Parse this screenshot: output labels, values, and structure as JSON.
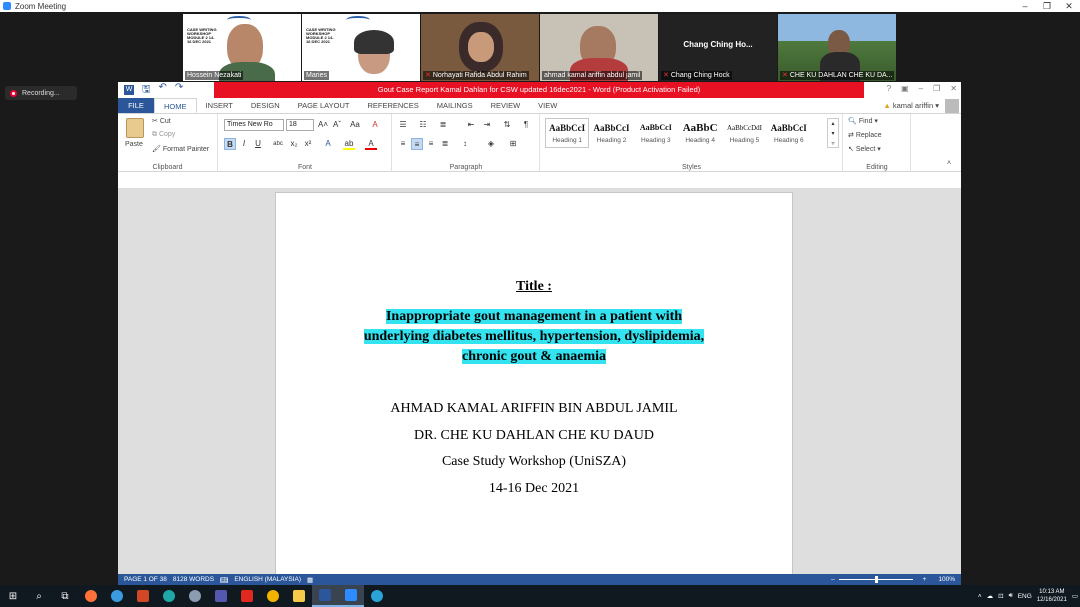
{
  "zoom": {
    "title": "Zoom Meeting",
    "recording_label": "Recording...",
    "participants": [
      {
        "name": "Hossein Nezakati",
        "muted": false,
        "type": "video"
      },
      {
        "name": "Maries",
        "muted": false,
        "type": "video"
      },
      {
        "name": "Norhayati Rafida Abdul Rahim",
        "muted": true,
        "type": "video"
      },
      {
        "name": "ahmad kamal ariffin abdul jamil",
        "muted": false,
        "type": "video"
      },
      {
        "name": "Chang Ching Hock",
        "display_big": "Chang Ching Ho...",
        "muted": true,
        "type": "no-video"
      },
      {
        "name": "CHE KU DAHLAN CHE KU DA...",
        "muted": true,
        "type": "video"
      }
    ],
    "slide_text": "CASE WRITING WORKSHOP MODULE 2 14-16 DEC 2021"
  },
  "word": {
    "title": "Gout Case Report Kamal Dahlan for CSW updated 16dec2021 - Word (Product Activation Failed)",
    "user": "kamal ariffin",
    "tabs": [
      "FILE",
      "HOME",
      "INSERT",
      "DESIGN",
      "PAGE LAYOUT",
      "REFERENCES",
      "MAILINGS",
      "REVIEW",
      "VIEW"
    ],
    "active_tab": "HOME",
    "clipboard": {
      "paste": "Paste",
      "cut": "Cut",
      "copy": "Copy",
      "format_painter": "Format Painter",
      "label": "Clipboard"
    },
    "font": {
      "name": "Times New Ro",
      "size": "18",
      "label": "Font"
    },
    "paragraph_label": "Paragraph",
    "styles": {
      "label": "Styles",
      "items": [
        {
          "preview": "AaBbCcI",
          "name": "Heading 1"
        },
        {
          "preview": "AaBbCcI",
          "name": "Heading 2"
        },
        {
          "preview": "AaBbCcI",
          "name": "Heading 3"
        },
        {
          "preview": "AaBbC",
          "name": "Heading 4"
        },
        {
          "preview": "AaBbCcDdI",
          "name": "Heading 5"
        },
        {
          "preview": "AaBbCcI",
          "name": "Heading 6"
        }
      ]
    },
    "editing": {
      "find": "Find",
      "replace": "Replace",
      "select": "Select",
      "label": "Editing"
    },
    "document": {
      "title": "Title :",
      "subtitle_lines": [
        "Inappropriate gout management in a patient with",
        "underlying diabetes mellitus, hypertension, dyslipidemia,",
        "chronic gout & anaemia"
      ],
      "lines": [
        "AHMAD KAMAL ARIFFIN BIN ABDUL JAMIL",
        "DR. CHE KU DAHLAN CHE KU DAUD",
        "Case Study Workshop (UniSZA)",
        "14-16 Dec 2021"
      ],
      "highlight_color": "#33e3f0"
    },
    "status": {
      "page": "PAGE 1 OF 38",
      "words": "8128 WORDS",
      "language": "ENGLISH (MALAYSIA)",
      "zoom": "100%"
    }
  },
  "taskbar": {
    "lang": "ENG",
    "time": "10:13 AM",
    "date": "12/16/2021"
  }
}
